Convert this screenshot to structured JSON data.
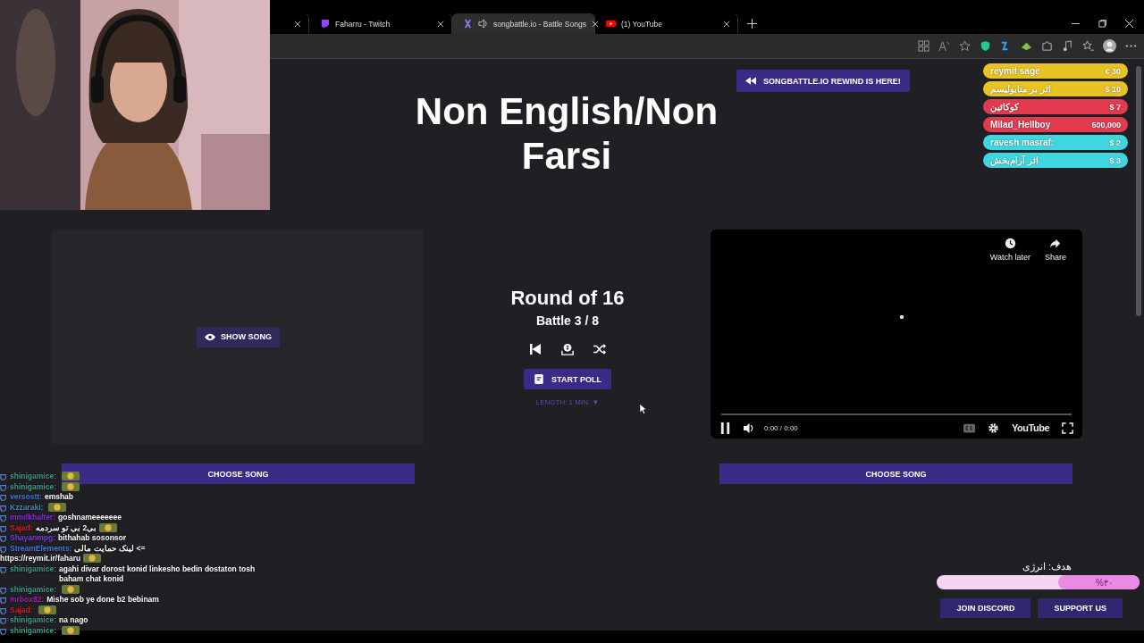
{
  "browser": {
    "tabs": [
      {
        "kind": "blank",
        "selected": false
      },
      {
        "kind": "twitch",
        "title": "Faharru - Twitch",
        "selected": false
      },
      {
        "kind": "songbattle",
        "title": "songbattle.io - Battle Songs",
        "selected": true,
        "audio": true
      },
      {
        "kind": "youtube",
        "title": "(1) YouTube",
        "selected": false
      }
    ]
  },
  "page": {
    "title": "Non English/Non Farsi",
    "rewind_button": "SONGBATTLE.IO REWIND IS HERE!",
    "show_song_button": "SHOW SONG",
    "round": "Round of 16",
    "battle": "Battle 3 / 8",
    "start_poll_button": "START POLL",
    "poll_length": "LENGTH: 1 MIN. ▼",
    "video": {
      "watch_later": "Watch later",
      "share": "Share",
      "time": "0:00 / 0:00",
      "logo": "YouTube"
    },
    "choose_buttons": [
      "CHOOSE SONG",
      "CHOOSE SONG"
    ],
    "footer_buttons": [
      "JOIN DISCORD",
      "SUPPORT US"
    ]
  },
  "donations": [
    {
      "name": "reymit sage",
      "amount": "€ 30",
      "color": "#e9c323"
    },
    {
      "name": "اثر بر متابولیسم",
      "amount": "$ 10",
      "color": "#e9c323"
    },
    {
      "name": "کوکائین",
      "amount": "$ 7",
      "color": "#e23a4f"
    },
    {
      "name": "Milad_Hellboy",
      "amount": "500,000",
      "color": "#e23a4f"
    },
    {
      "name": "ravesh masraf:",
      "amount": "$ 2",
      "color": "#3fd6df"
    },
    {
      "name": "اثر آرام‌بخش",
      "amount": "$ 3",
      "color": "#3fd6df"
    }
  ],
  "chat": [
    {
      "user": "shinigamice:",
      "color": "#3f9c8c",
      "emote": true
    },
    {
      "user": "shinigamice:",
      "color": "#3f9c8c",
      "emote": true
    },
    {
      "user": "versostt:",
      "color": "#3a7be0",
      "text": "emshab"
    },
    {
      "user": "Kzzaraki:",
      "color": "#3d8fb5",
      "emote": true
    },
    {
      "user": "mmdkhalter:",
      "color": "#8a2be2",
      "text": "goshnameeeeeee"
    },
    {
      "user": "Sajad:",
      "color": "#d0202a",
      "text": "بی2 بی تو سردمه",
      "emote": true
    },
    {
      "user": "Shayanmpg:",
      "color": "#7b3fe4",
      "text": "bithahab sosonsor"
    },
    {
      "user": "StreamElements:",
      "color": "#4a78d8",
      "text": "لینک حمایت مالی <=",
      "link": "https://reymit.ir/faharu",
      "emote": true
    },
    {
      "user": "shinigamice:",
      "color": "#3f9c8c",
      "text": "agahi divar dorost konid linkesho bedin dostaton tosh baham chat konid"
    },
    {
      "user": "shinigamice:",
      "color": "#3f9c8c",
      "emote": true
    },
    {
      "user": "mrbox82:",
      "color": "#a020c0",
      "text": "Mishe sob ye done b2 bebinam"
    },
    {
      "user": "Sajad:",
      "color": "#d0202a",
      "emote": true
    },
    {
      "user": "shinigamice:",
      "color": "#3f9c8c",
      "text": "na nago"
    },
    {
      "user": "shinigamice:",
      "color": "#3f9c8c",
      "emote": true
    }
  ],
  "goal": {
    "label": "هدف: انرژی",
    "percent": "%۴۰",
    "level": 0.4
  }
}
